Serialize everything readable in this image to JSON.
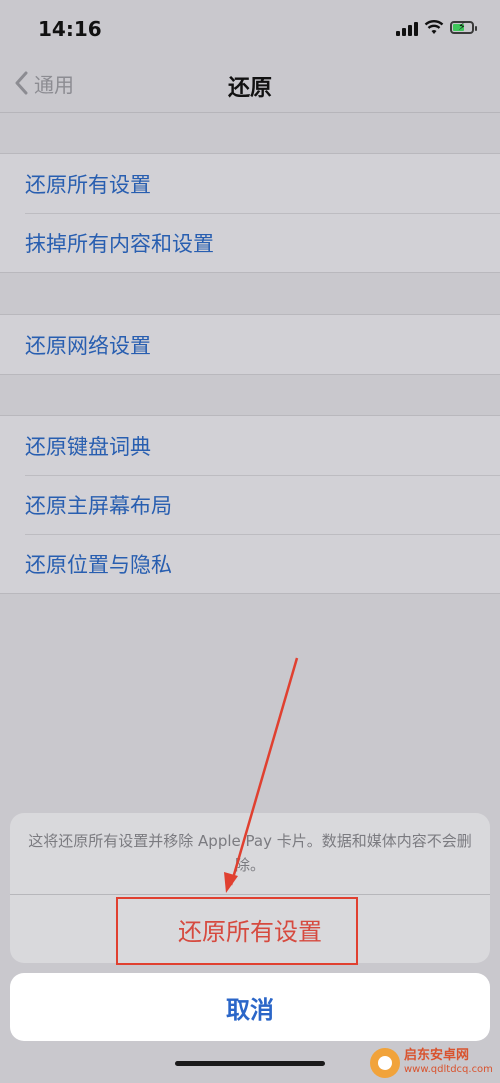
{
  "status_bar": {
    "time": "14:16",
    "icons": [
      "signal-icon",
      "wifi-icon",
      "battery-charging-icon"
    ]
  },
  "nav": {
    "back_label": "通用",
    "title": "还原"
  },
  "groups": [
    {
      "items": [
        "还原所有设置",
        "抹掉所有内容和设置"
      ]
    },
    {
      "items": [
        "还原网络设置"
      ]
    },
    {
      "items": [
        "还原键盘词典",
        "还原主屏幕布局",
        "还原位置与隐私"
      ]
    }
  ],
  "action_sheet": {
    "message": "这将还原所有设置并移除 Apple Pay 卡片。数据和媒体内容不会删除。",
    "destructive_label": "还原所有设置",
    "cancel_label": "取消"
  },
  "watermark": {
    "name": "启东安卓网",
    "url": "www.qdltdcq.com"
  },
  "colors": {
    "link": "#285eb0",
    "destructive": "#d64a3f",
    "cancel": "#2b66c8",
    "annotation": "#e04030"
  }
}
